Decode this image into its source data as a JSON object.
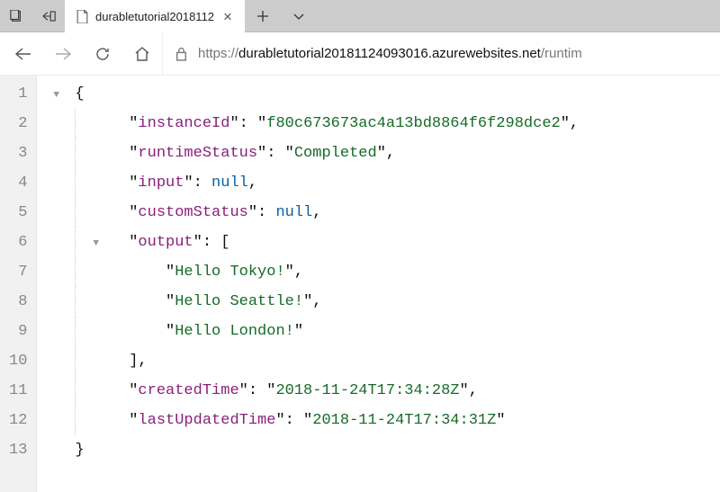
{
  "tab": {
    "title": "durabletutorial2018112"
  },
  "url": {
    "protocol": "https://",
    "host": "durabletutorial20181124093016.azurewebsites.net",
    "path": "/runtim"
  },
  "json": {
    "keys": {
      "instanceId": "instanceId",
      "runtimeStatus": "runtimeStatus",
      "input": "input",
      "customStatus": "customStatus",
      "output": "output",
      "createdTime": "createdTime",
      "lastUpdatedTime": "lastUpdatedTime"
    },
    "values": {
      "instanceId": "f80c673673ac4a13bd8864f6f298dce2",
      "runtimeStatus": "Completed",
      "input": "null",
      "customStatus": "null",
      "output": [
        "Hello Tokyo!",
        "Hello Seattle!",
        "Hello London!"
      ],
      "createdTime": "2018-11-24T17:34:28Z",
      "lastUpdatedTime": "2018-11-24T17:34:31Z"
    }
  },
  "lineNumbers": [
    "1",
    "2",
    "3",
    "4",
    "5",
    "6",
    "7",
    "8",
    "9",
    "10",
    "11",
    "12",
    "13"
  ]
}
